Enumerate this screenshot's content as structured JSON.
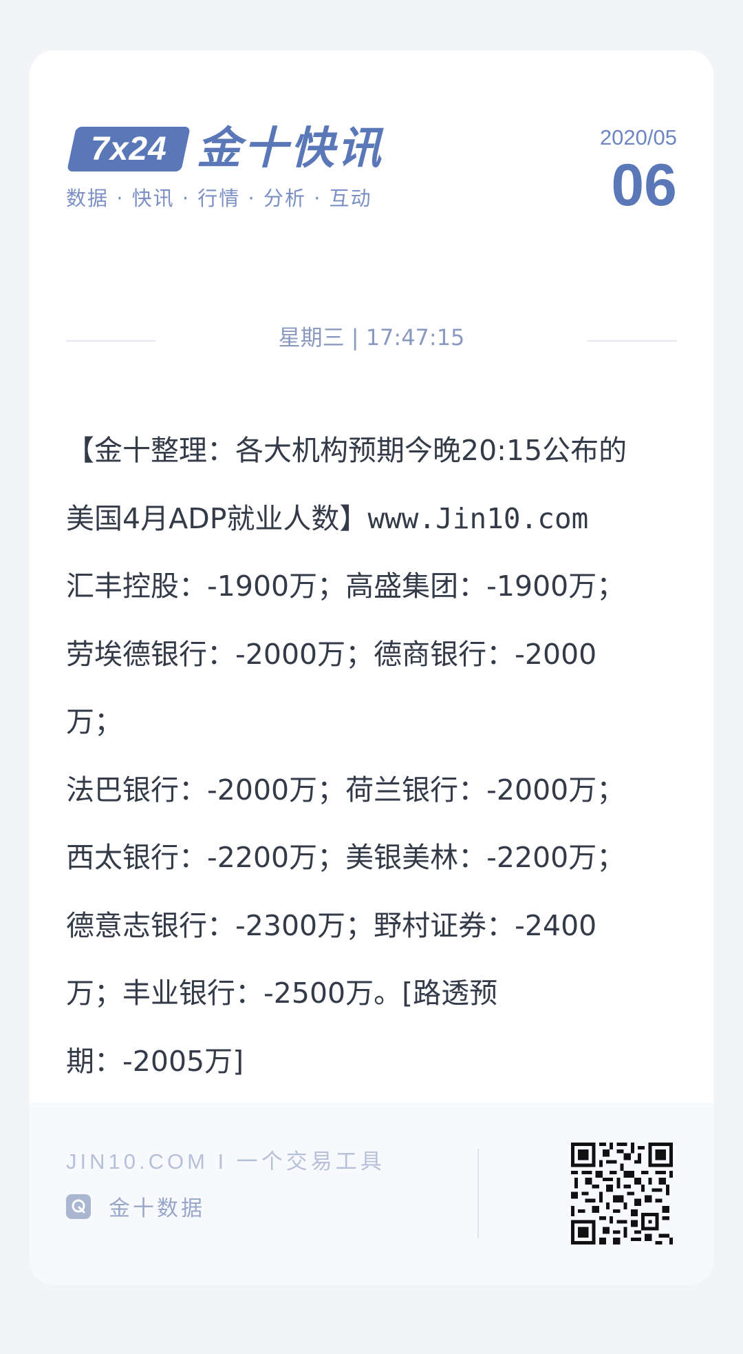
{
  "header": {
    "logo_badge": "7x24",
    "logo_title": "金十快讯",
    "tagline": "数据 · 快讯 · 行情 · 分析 · 互动",
    "date_year_month": "2020/05",
    "date_day": "06",
    "weekday_time": "星期三 | 17:47:15"
  },
  "article": {
    "lines": [
      "【金十整理：各大机构预期今晚20:15公布的",
      "美国4月ADP就业人数】",
      "汇丰控股：-1900万；高盛集团：-1900万；",
      "劳埃德银行：-2000万；德商银行：-2000",
      "万；",
      "法巴银行：-2000万；荷兰银行：-2000万；",
      "西太银行：-2200万；美银美林：-2200万；",
      "德意志银行：-2300万；野村证券：-2400",
      "万；丰业银行：-2500万。[路透预",
      "期：-2005万]"
    ],
    "link_text": "www.Jin10.com"
  },
  "footer": {
    "site": "JIN10.COM  I  一个交易工具",
    "brand_icon": "q-logo-icon",
    "brand_name": "金十数据",
    "qr_icon": "qr-code-icon"
  },
  "colors": {
    "brand_blue": "#5a77b8",
    "text": "#333a48",
    "muted": "#8a99bf",
    "background": "#f3f4f8"
  }
}
